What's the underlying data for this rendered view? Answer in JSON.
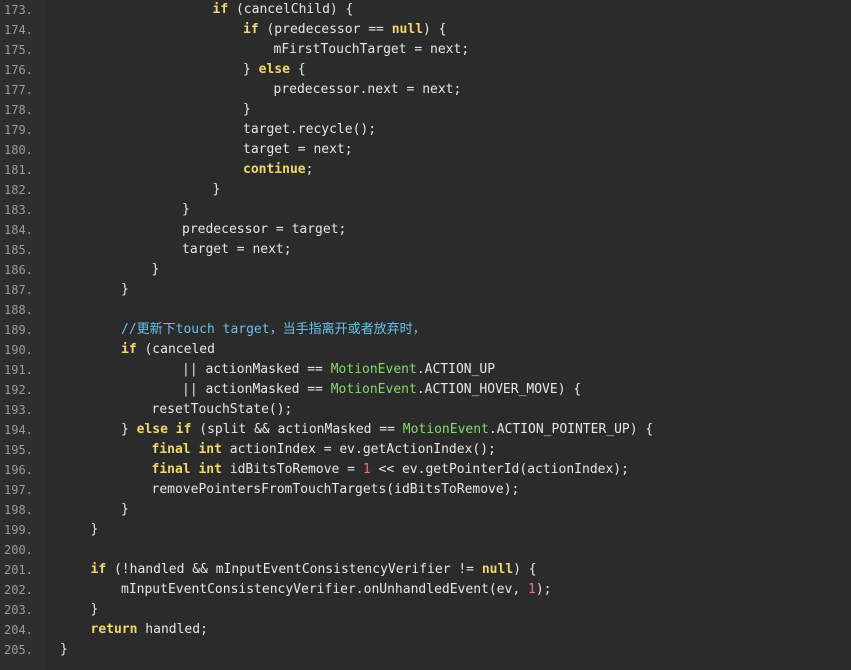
{
  "colors": {
    "background": "#2b2b2b",
    "gutter": "#2e2e2e",
    "line_number": "#9b9b9b",
    "text": "#e6e6e6",
    "keyword": "#f0d86a",
    "type": "#86d86b",
    "comment": "#6cc0e8",
    "number": "#f07070"
  },
  "lines": [
    {
      "num": "173.",
      "indent": 5,
      "tokens": [
        {
          "t": "kw",
          "v": "if"
        },
        {
          "t": "txt",
          "v": " (cancelChild) {"
        }
      ]
    },
    {
      "num": "174.",
      "indent": 6,
      "tokens": [
        {
          "t": "kw",
          "v": "if"
        },
        {
          "t": "txt",
          "v": " (predecessor == "
        },
        {
          "t": "kw",
          "v": "null"
        },
        {
          "t": "txt",
          "v": ") {"
        }
      ]
    },
    {
      "num": "175.",
      "indent": 7,
      "tokens": [
        {
          "t": "txt",
          "v": "mFirstTouchTarget = next;"
        }
      ]
    },
    {
      "num": "176.",
      "indent": 6,
      "tokens": [
        {
          "t": "txt",
          "v": "} "
        },
        {
          "t": "kw",
          "v": "else"
        },
        {
          "t": "txt",
          "v": " {"
        }
      ]
    },
    {
      "num": "177.",
      "indent": 7,
      "tokens": [
        {
          "t": "txt",
          "v": "predecessor.next = next;"
        }
      ]
    },
    {
      "num": "178.",
      "indent": 6,
      "tokens": [
        {
          "t": "txt",
          "v": "}"
        }
      ]
    },
    {
      "num": "179.",
      "indent": 6,
      "tokens": [
        {
          "t": "txt",
          "v": "target.recycle();"
        }
      ]
    },
    {
      "num": "180.",
      "indent": 6,
      "tokens": [
        {
          "t": "txt",
          "v": "target = next;"
        }
      ]
    },
    {
      "num": "181.",
      "indent": 6,
      "tokens": [
        {
          "t": "kw",
          "v": "continue"
        },
        {
          "t": "txt",
          "v": ";"
        }
      ]
    },
    {
      "num": "182.",
      "indent": 5,
      "tokens": [
        {
          "t": "txt",
          "v": "}"
        }
      ]
    },
    {
      "num": "183.",
      "indent": 4,
      "tokens": [
        {
          "t": "txt",
          "v": "}"
        }
      ]
    },
    {
      "num": "184.",
      "indent": 4,
      "tokens": [
        {
          "t": "txt",
          "v": "predecessor = target;"
        }
      ]
    },
    {
      "num": "185.",
      "indent": 4,
      "tokens": [
        {
          "t": "txt",
          "v": "target = next;"
        }
      ]
    },
    {
      "num": "186.",
      "indent": 3,
      "tokens": [
        {
          "t": "txt",
          "v": "}"
        }
      ]
    },
    {
      "num": "187.",
      "indent": 2,
      "tokens": [
        {
          "t": "txt",
          "v": "}"
        }
      ]
    },
    {
      "num": "188.",
      "indent": 0,
      "tokens": []
    },
    {
      "num": "189.",
      "indent": 2,
      "tokens": [
        {
          "t": "cm",
          "v": "//更新下touch target，当手指离开或者放弃时，"
        }
      ]
    },
    {
      "num": "190.",
      "indent": 2,
      "tokens": [
        {
          "t": "kw",
          "v": "if"
        },
        {
          "t": "txt",
          "v": " (canceled"
        }
      ]
    },
    {
      "num": "191.",
      "indent": 4,
      "tokens": [
        {
          "t": "txt",
          "v": "|| actionMasked == "
        },
        {
          "t": "type",
          "v": "MotionEvent"
        },
        {
          "t": "txt",
          "v": ".ACTION_UP"
        }
      ]
    },
    {
      "num": "192.",
      "indent": 4,
      "tokens": [
        {
          "t": "txt",
          "v": "|| actionMasked == "
        },
        {
          "t": "type",
          "v": "MotionEvent"
        },
        {
          "t": "txt",
          "v": ".ACTION_HOVER_MOVE) {"
        }
      ]
    },
    {
      "num": "193.",
      "indent": 3,
      "tokens": [
        {
          "t": "txt",
          "v": "resetTouchState();"
        }
      ]
    },
    {
      "num": "194.",
      "indent": 2,
      "tokens": [
        {
          "t": "txt",
          "v": "} "
        },
        {
          "t": "kw",
          "v": "else if"
        },
        {
          "t": "txt",
          "v": " (split && actionMasked == "
        },
        {
          "t": "type",
          "v": "MotionEvent"
        },
        {
          "t": "txt",
          "v": ".ACTION_POINTER_UP) {"
        }
      ]
    },
    {
      "num": "195.",
      "indent": 3,
      "tokens": [
        {
          "t": "kw",
          "v": "final int"
        },
        {
          "t": "txt",
          "v": " actionIndex = ev.getActionIndex();"
        }
      ]
    },
    {
      "num": "196.",
      "indent": 3,
      "tokens": [
        {
          "t": "kw",
          "v": "final int"
        },
        {
          "t": "txt",
          "v": " idBitsToRemove = "
        },
        {
          "t": "num",
          "v": "1"
        },
        {
          "t": "txt",
          "v": " << ev.getPointerId(actionIndex);"
        }
      ]
    },
    {
      "num": "197.",
      "indent": 3,
      "tokens": [
        {
          "t": "txt",
          "v": "removePointersFromTouchTargets(idBitsToRemove);"
        }
      ]
    },
    {
      "num": "198.",
      "indent": 2,
      "tokens": [
        {
          "t": "txt",
          "v": "}"
        }
      ]
    },
    {
      "num": "199.",
      "indent": 1,
      "tokens": [
        {
          "t": "txt",
          "v": "}"
        }
      ]
    },
    {
      "num": "200.",
      "indent": 0,
      "tokens": []
    },
    {
      "num": "201.",
      "indent": 1,
      "tokens": [
        {
          "t": "kw",
          "v": "if"
        },
        {
          "t": "txt",
          "v": " (!handled && mInputEventConsistencyVerifier != "
        },
        {
          "t": "kw",
          "v": "null"
        },
        {
          "t": "txt",
          "v": ") {"
        }
      ]
    },
    {
      "num": "202.",
      "indent": 2,
      "tokens": [
        {
          "t": "txt",
          "v": "mInputEventConsistencyVerifier.onUnhandledEvent(ev, "
        },
        {
          "t": "num",
          "v": "1"
        },
        {
          "t": "txt",
          "v": ");"
        }
      ]
    },
    {
      "num": "203.",
      "indent": 1,
      "tokens": [
        {
          "t": "txt",
          "v": "}"
        }
      ]
    },
    {
      "num": "204.",
      "indent": 1,
      "tokens": [
        {
          "t": "kw",
          "v": "return"
        },
        {
          "t": "txt",
          "v": " handled;"
        }
      ]
    },
    {
      "num": "205.",
      "indent": 0,
      "tokens": [
        {
          "t": "txt",
          "v": "}"
        }
      ]
    }
  ]
}
